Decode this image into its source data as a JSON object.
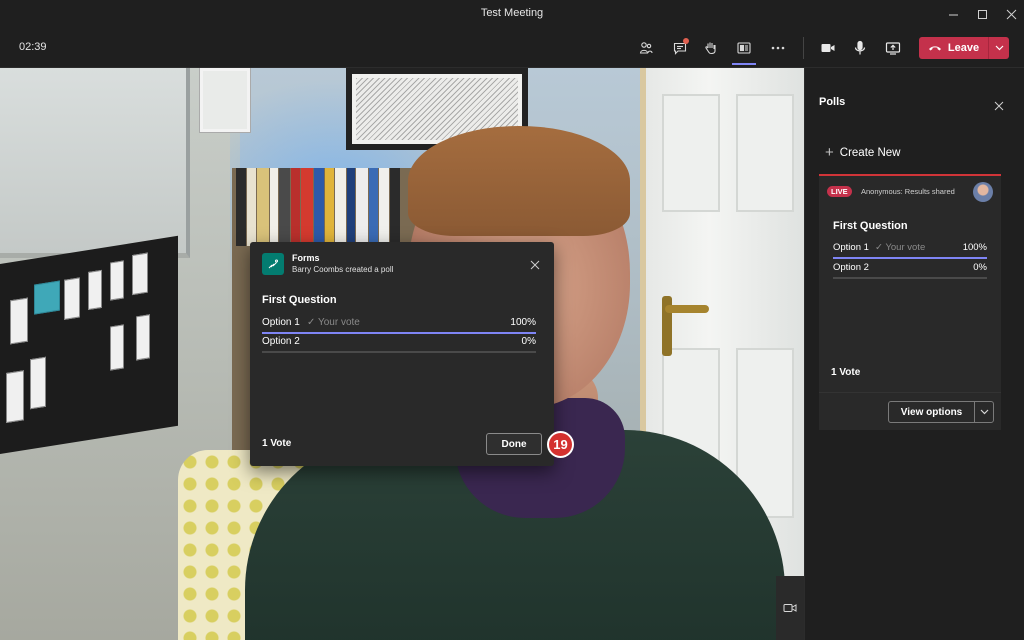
{
  "window": {
    "title": "Test Meeting"
  },
  "toolbar": {
    "timer": "02:39",
    "icons": [
      "people-icon",
      "chat-icon",
      "raise-hand-icon",
      "apps-icon",
      "more-icon",
      "camera-icon",
      "microphone-icon",
      "share-icon"
    ],
    "leave_label": "Leave"
  },
  "popup": {
    "app_name": "Forms",
    "creator": "Barry Coombs created a poll",
    "question": "First Question",
    "options": [
      {
        "label": "Option 1",
        "your_vote": "Your vote",
        "percent": "100%",
        "fraction": 1.0
      },
      {
        "label": "Option 2",
        "your_vote": "",
        "percent": "0%",
        "fraction": 0.0
      }
    ],
    "votes": "1 Vote",
    "done_label": "Done"
  },
  "step_badge": "19",
  "polls": {
    "title": "Polls",
    "create_new": "Create New",
    "live_badge": "LIVE",
    "status": "Anonymous: Results shared",
    "question": "First Question",
    "options": [
      {
        "label": "Option 1",
        "your_vote": "Your vote",
        "percent": "100%",
        "fraction": 1.0
      },
      {
        "label": "Option 2",
        "your_vote": "",
        "percent": "0%",
        "fraction": 0.0
      }
    ],
    "votes": "1 Vote",
    "view_options": "View options"
  },
  "colors": {
    "accent": "#7f85f5",
    "leave": "#c4314b",
    "live": "#c4314b",
    "forms_green": "#037c70",
    "badge": "#d4312f"
  }
}
